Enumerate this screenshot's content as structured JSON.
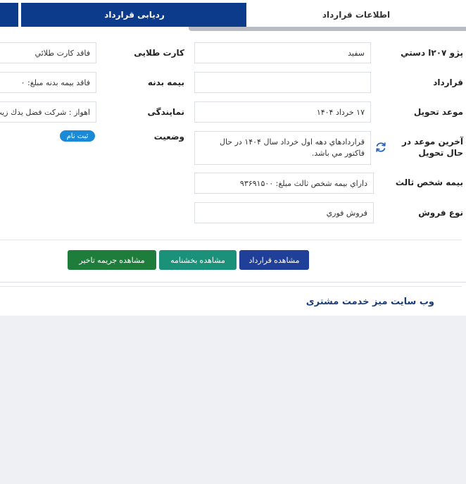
{
  "tabs": {
    "contract_info": "اطلاعات قرارداد",
    "contract_tracking": "ردیابی قرارداد"
  },
  "left_column": {
    "product": {
      "label": "پژو ۲۰۷ا دستي",
      "value": "سفيد"
    },
    "contract": {
      "label": "قرارداد",
      "value": ""
    },
    "delivery_date": {
      "label": "موعد تحویل",
      "value": "۱۷ خرداد ۱۴۰۴"
    },
    "last_delivery_date": {
      "label": "آخرین موعد در حال تحویل",
      "value": "قراردادهاي دهه اول خرداد سال ۱۴۰۴ در حال فاکتور مي باشد."
    },
    "third_party_insurance": {
      "label": "بیمه شخص ثالث",
      "value": "داراي بيمه شخص ثالث مبلغ: ۹۳۶۹۱۵۰۰"
    },
    "sale_type": {
      "label": "نوع فروش",
      "value": "فروش فوري"
    }
  },
  "right_column": {
    "gold_card": {
      "label": "کارت طلایی",
      "value": "فاقد کارت طلائي"
    },
    "body_insurance": {
      "label": "بیمه بدنه",
      "value": "فاقد بيمه بدنه مبلغ: ۰"
    },
    "dealership": {
      "label": "نمایندگی",
      "value": "اهواز : شرکت فضل یدك زیب"
    },
    "status": {
      "label": "وضعیت",
      "badge": "ثبت نام"
    }
  },
  "buttons": {
    "view_contract": "مشاهده قرارداد",
    "view_circular": "مشاهده بخشنامه",
    "view_delay_fine": "مشاهده جريمه تاخير"
  },
  "footer": {
    "title": "وب سایت میز خدمت مشتری"
  },
  "icons": {
    "refresh": "refresh-icon"
  },
  "colors": {
    "tab_active": "#0d3b8c",
    "btn_contract": "#1f3f98",
    "btn_circular": "#1a9178",
    "btn_fine": "#1f7d3c",
    "badge": "#1a8ad6"
  }
}
